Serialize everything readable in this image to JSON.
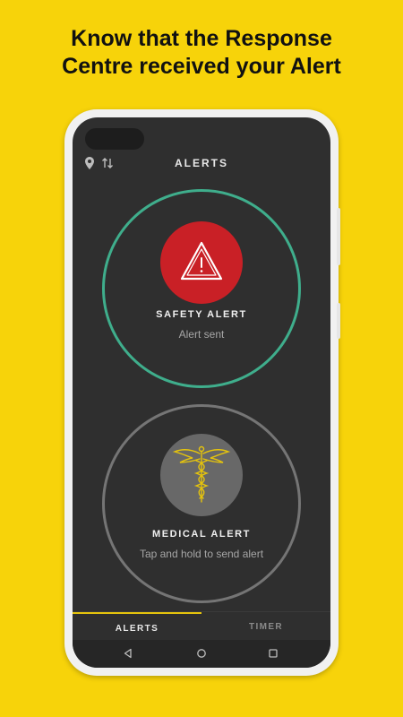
{
  "headline": {
    "line1": "Know that the Response",
    "line2": "Centre received your Alert"
  },
  "screen": {
    "title": "ALERTS",
    "status_icons": [
      "location-pin-icon",
      "sync-arrows-icon"
    ]
  },
  "safety_alert": {
    "label": "SAFETY ALERT",
    "status": "Alert sent",
    "icon": "warning-triangle-icon",
    "button_color": "#c92026",
    "ring_color": "#3fae8c"
  },
  "medical_alert": {
    "label": "MEDICAL ALERT",
    "status": "Tap and hold to send alert",
    "icon": "caduceus-icon",
    "icon_color": "#e6c40c"
  },
  "tabs": [
    {
      "label": "ALERTS",
      "active": true
    },
    {
      "label": "TIMER",
      "active": false
    }
  ],
  "navigation": [
    "back-icon",
    "home-icon",
    "recent-apps-icon"
  ],
  "colors": {
    "background": "#f7d30a",
    "screen": "#2f2f2f",
    "tab_indicator": "#e6c40c"
  }
}
